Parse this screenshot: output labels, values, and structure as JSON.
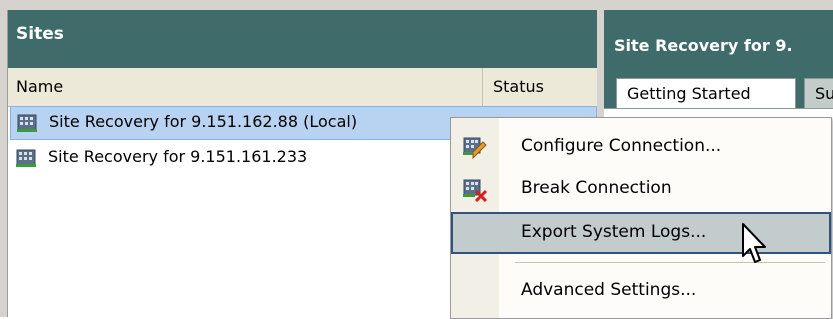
{
  "sites_panel": {
    "title": "Sites",
    "columns": [
      "Name",
      "Status"
    ],
    "rows": [
      {
        "label": "Site Recovery for 9.151.162.88 (Local)",
        "selected": true
      },
      {
        "label": "Site Recovery for 9.151.161.233",
        "selected": false
      }
    ]
  },
  "detail_panel": {
    "title": "Site Recovery for 9.",
    "tabs": [
      "Getting Started",
      "Su"
    ]
  },
  "context_menu": {
    "items": [
      {
        "label": "Configure Connection...",
        "icon": "configure-connection-icon"
      },
      {
        "label": "Break Connection",
        "icon": "break-connection-icon"
      },
      {
        "label": "Export System Logs...",
        "icon": "",
        "highlighted": true
      },
      {
        "label": "Advanced Settings...",
        "icon": ""
      }
    ]
  },
  "colors": {
    "header_bg": "#3f6c6b",
    "selection_bg": "#b8d3f2",
    "menu_highlight": "#c2cccd"
  }
}
